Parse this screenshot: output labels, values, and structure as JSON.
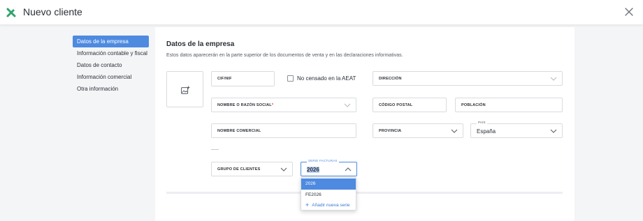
{
  "header": {
    "title": "Nuevo cliente"
  },
  "sidebar": {
    "items": [
      {
        "label": "Datos de la empresa"
      },
      {
        "label": "Información contable y fiscal"
      },
      {
        "label": "Datos de contacto"
      },
      {
        "label": "Información comercial"
      },
      {
        "label": "Otra información"
      }
    ]
  },
  "section": {
    "title": "Datos de la empresa",
    "description": "Estos datos aparecerán en la parte superior de los documentos de venta y en las declaraciones informativas."
  },
  "form": {
    "cif": {
      "label": "CIF/NIF"
    },
    "no_censado": {
      "label": "No censado en la AEAT",
      "checked": false
    },
    "direccion": {
      "label": "DIRECCIÓN"
    },
    "nombre": {
      "label": "NOMBRE O RAZÓN SOCIAL",
      "required_mark": "*"
    },
    "codigo_postal": {
      "label": "CÓDIGO POSTAL"
    },
    "poblacion": {
      "label": "POBLACIÓN"
    },
    "nombre_comercial": {
      "label": "NOMBRE COMERCIAL"
    },
    "provincia": {
      "label": "PROVINCIA"
    },
    "pais": {
      "label": "PAÍS",
      "value": "España"
    },
    "grupo_clientes": {
      "label": "GRUPO DE CLIENTES"
    },
    "serie_facturas": {
      "label": "SERIE FACTURAS",
      "value": "2026"
    }
  },
  "dropdown": {
    "options": [
      "2026",
      "FE2026"
    ],
    "selected": "2026",
    "add_label": "Añadir nueva serie"
  },
  "colors": {
    "accent": "#4d8ae0",
    "brand": "#2fa36b",
    "required": "#d2333b"
  }
}
